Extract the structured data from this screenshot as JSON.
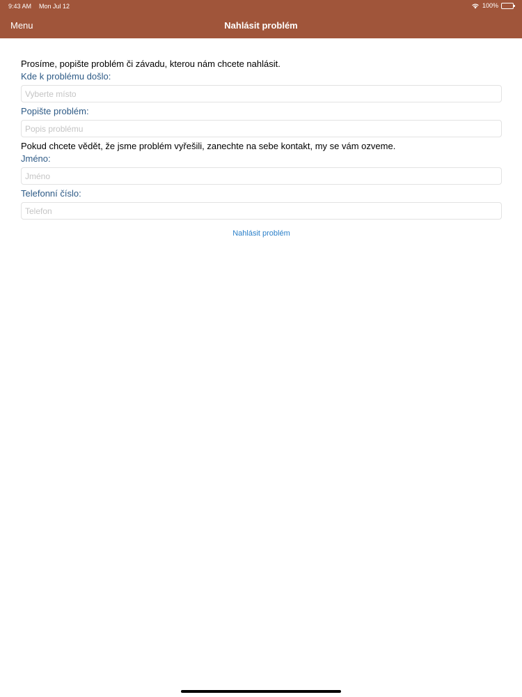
{
  "status_bar": {
    "time": "9:43 AM",
    "date": "Mon Jul 12",
    "battery": "100%",
    "wifi_icon": "wifi-icon",
    "battery_icon": "battery-icon"
  },
  "header": {
    "menu_label": "Menu",
    "title": "Nahlásit problém",
    "color": "#a0553a"
  },
  "form": {
    "intro": "Prosíme, popište problém či závadu, kterou nám chcete nahlásit.",
    "location": {
      "label": "Kde k problému došlo:",
      "placeholder": "Vyberte místo",
      "value": ""
    },
    "description": {
      "label": "Popište problém:",
      "placeholder": "Popis problému",
      "value": ""
    },
    "contact_intro": "Pokud chcete vědět, že jsme problém vyřešili, zanechte na sebe kontakt, my se vám ozveme.",
    "name": {
      "label": "Jméno:",
      "placeholder": "Jméno",
      "value": ""
    },
    "phone": {
      "label": "Telefonní číslo:",
      "placeholder": "Telefon",
      "value": ""
    },
    "submit_label": "Nahlásit problém",
    "label_color": "#2d5a86",
    "link_color": "#2a7fc9"
  }
}
